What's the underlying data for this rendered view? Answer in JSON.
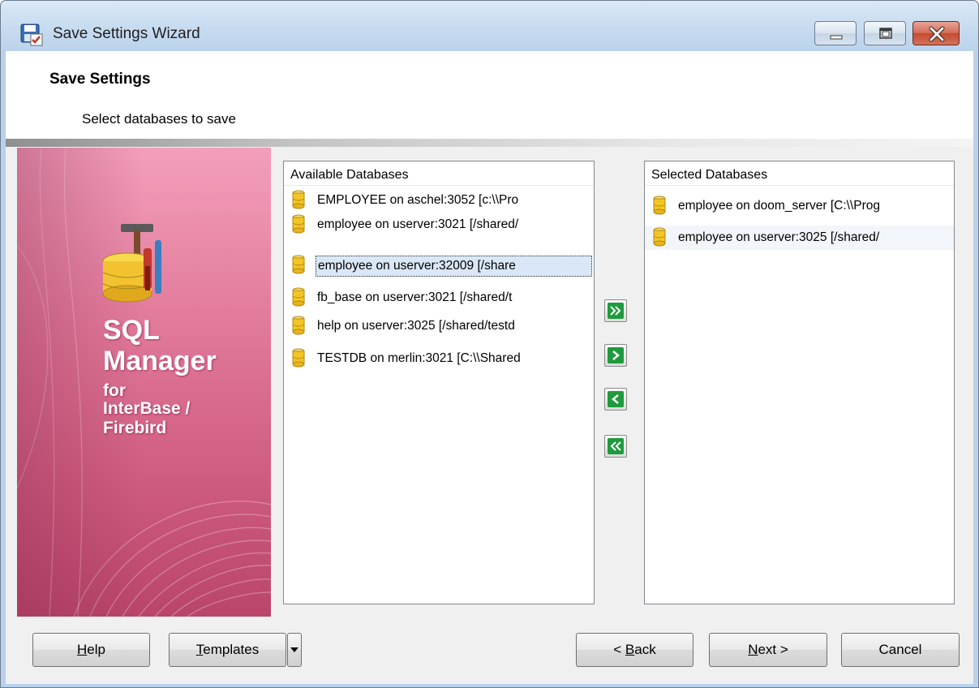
{
  "window": {
    "title": "Save Settings Wizard"
  },
  "header": {
    "title": "Save Settings",
    "subtitle": "Select databases to save"
  },
  "banner": {
    "line1": "SQL",
    "line2": "Manager",
    "line3": "for",
    "line4": "InterBase /",
    "line5": "Firebird"
  },
  "available": {
    "header": "Available Databases",
    "items": [
      "EMPLOYEE on aschel:3052 [c:\\\\Pro",
      "employee on userver:3021 [/shared/",
      "employee on userver:32009 [/share",
      "fb_base on userver:3021 [/shared/t",
      "help on userver:3025 [/shared/testd",
      "TESTDB on merlin:3021 [C:\\\\Shared"
    ]
  },
  "selected": {
    "header": "Selected Databases",
    "items": [
      "employee on doom_server [C:\\\\Prog",
      "employee on userver:3025 [/shared/"
    ]
  },
  "move_buttons": {
    "add_all_icon": "double-right-arrow-icon",
    "add_one_icon": "right-arrow-icon",
    "remove_one_icon": "left-arrow-icon",
    "remove_all_icon": "double-left-arrow-icon",
    "color": "#1f9a3c"
  },
  "footer": {
    "help_accel": "H",
    "help_rest": "elp",
    "templates_accel": "T",
    "templates_rest": "emplates",
    "back_prefix": "< ",
    "back_accel": "B",
    "back_rest": "ack",
    "next_accel": "N",
    "next_rest": "ext >",
    "cancel": "Cancel"
  }
}
